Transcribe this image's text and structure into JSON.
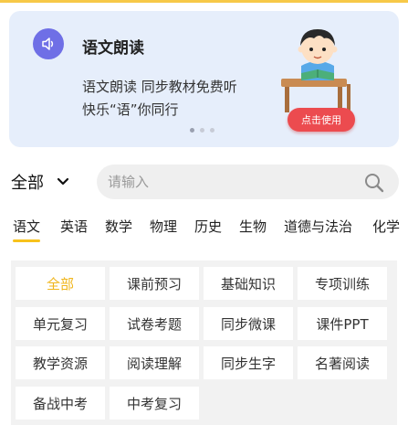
{
  "banner": {
    "title": "语文朗读",
    "line1": "语文朗读 同步教材免费听",
    "line2": "快乐“语”你同行",
    "cta": "点击使用",
    "icon": "speaker-icon",
    "accent": "#6f6fe6",
    "cta_color": "#ec4b4f",
    "active_dot": 1
  },
  "filter": {
    "scope": "全部",
    "search_placeholder": "请输入"
  },
  "subjects": {
    "active": "语文",
    "items": [
      "语文",
      "英语",
      "数学",
      "物理",
      "历史",
      "生物",
      "道德与法治",
      "化学"
    ]
  },
  "categories": {
    "active": "全部",
    "items": [
      "全部",
      "课前预习",
      "基础知识",
      "专项训练",
      "单元复习",
      "试卷考题",
      "同步微课",
      "课件PPT",
      "教学资源",
      "阅读理解",
      "同步生字",
      "名著阅读",
      "备战中考",
      "中考复习"
    ]
  },
  "colors": {
    "highlight": "#f7c21c",
    "banner_bg": "#e6eefb"
  }
}
